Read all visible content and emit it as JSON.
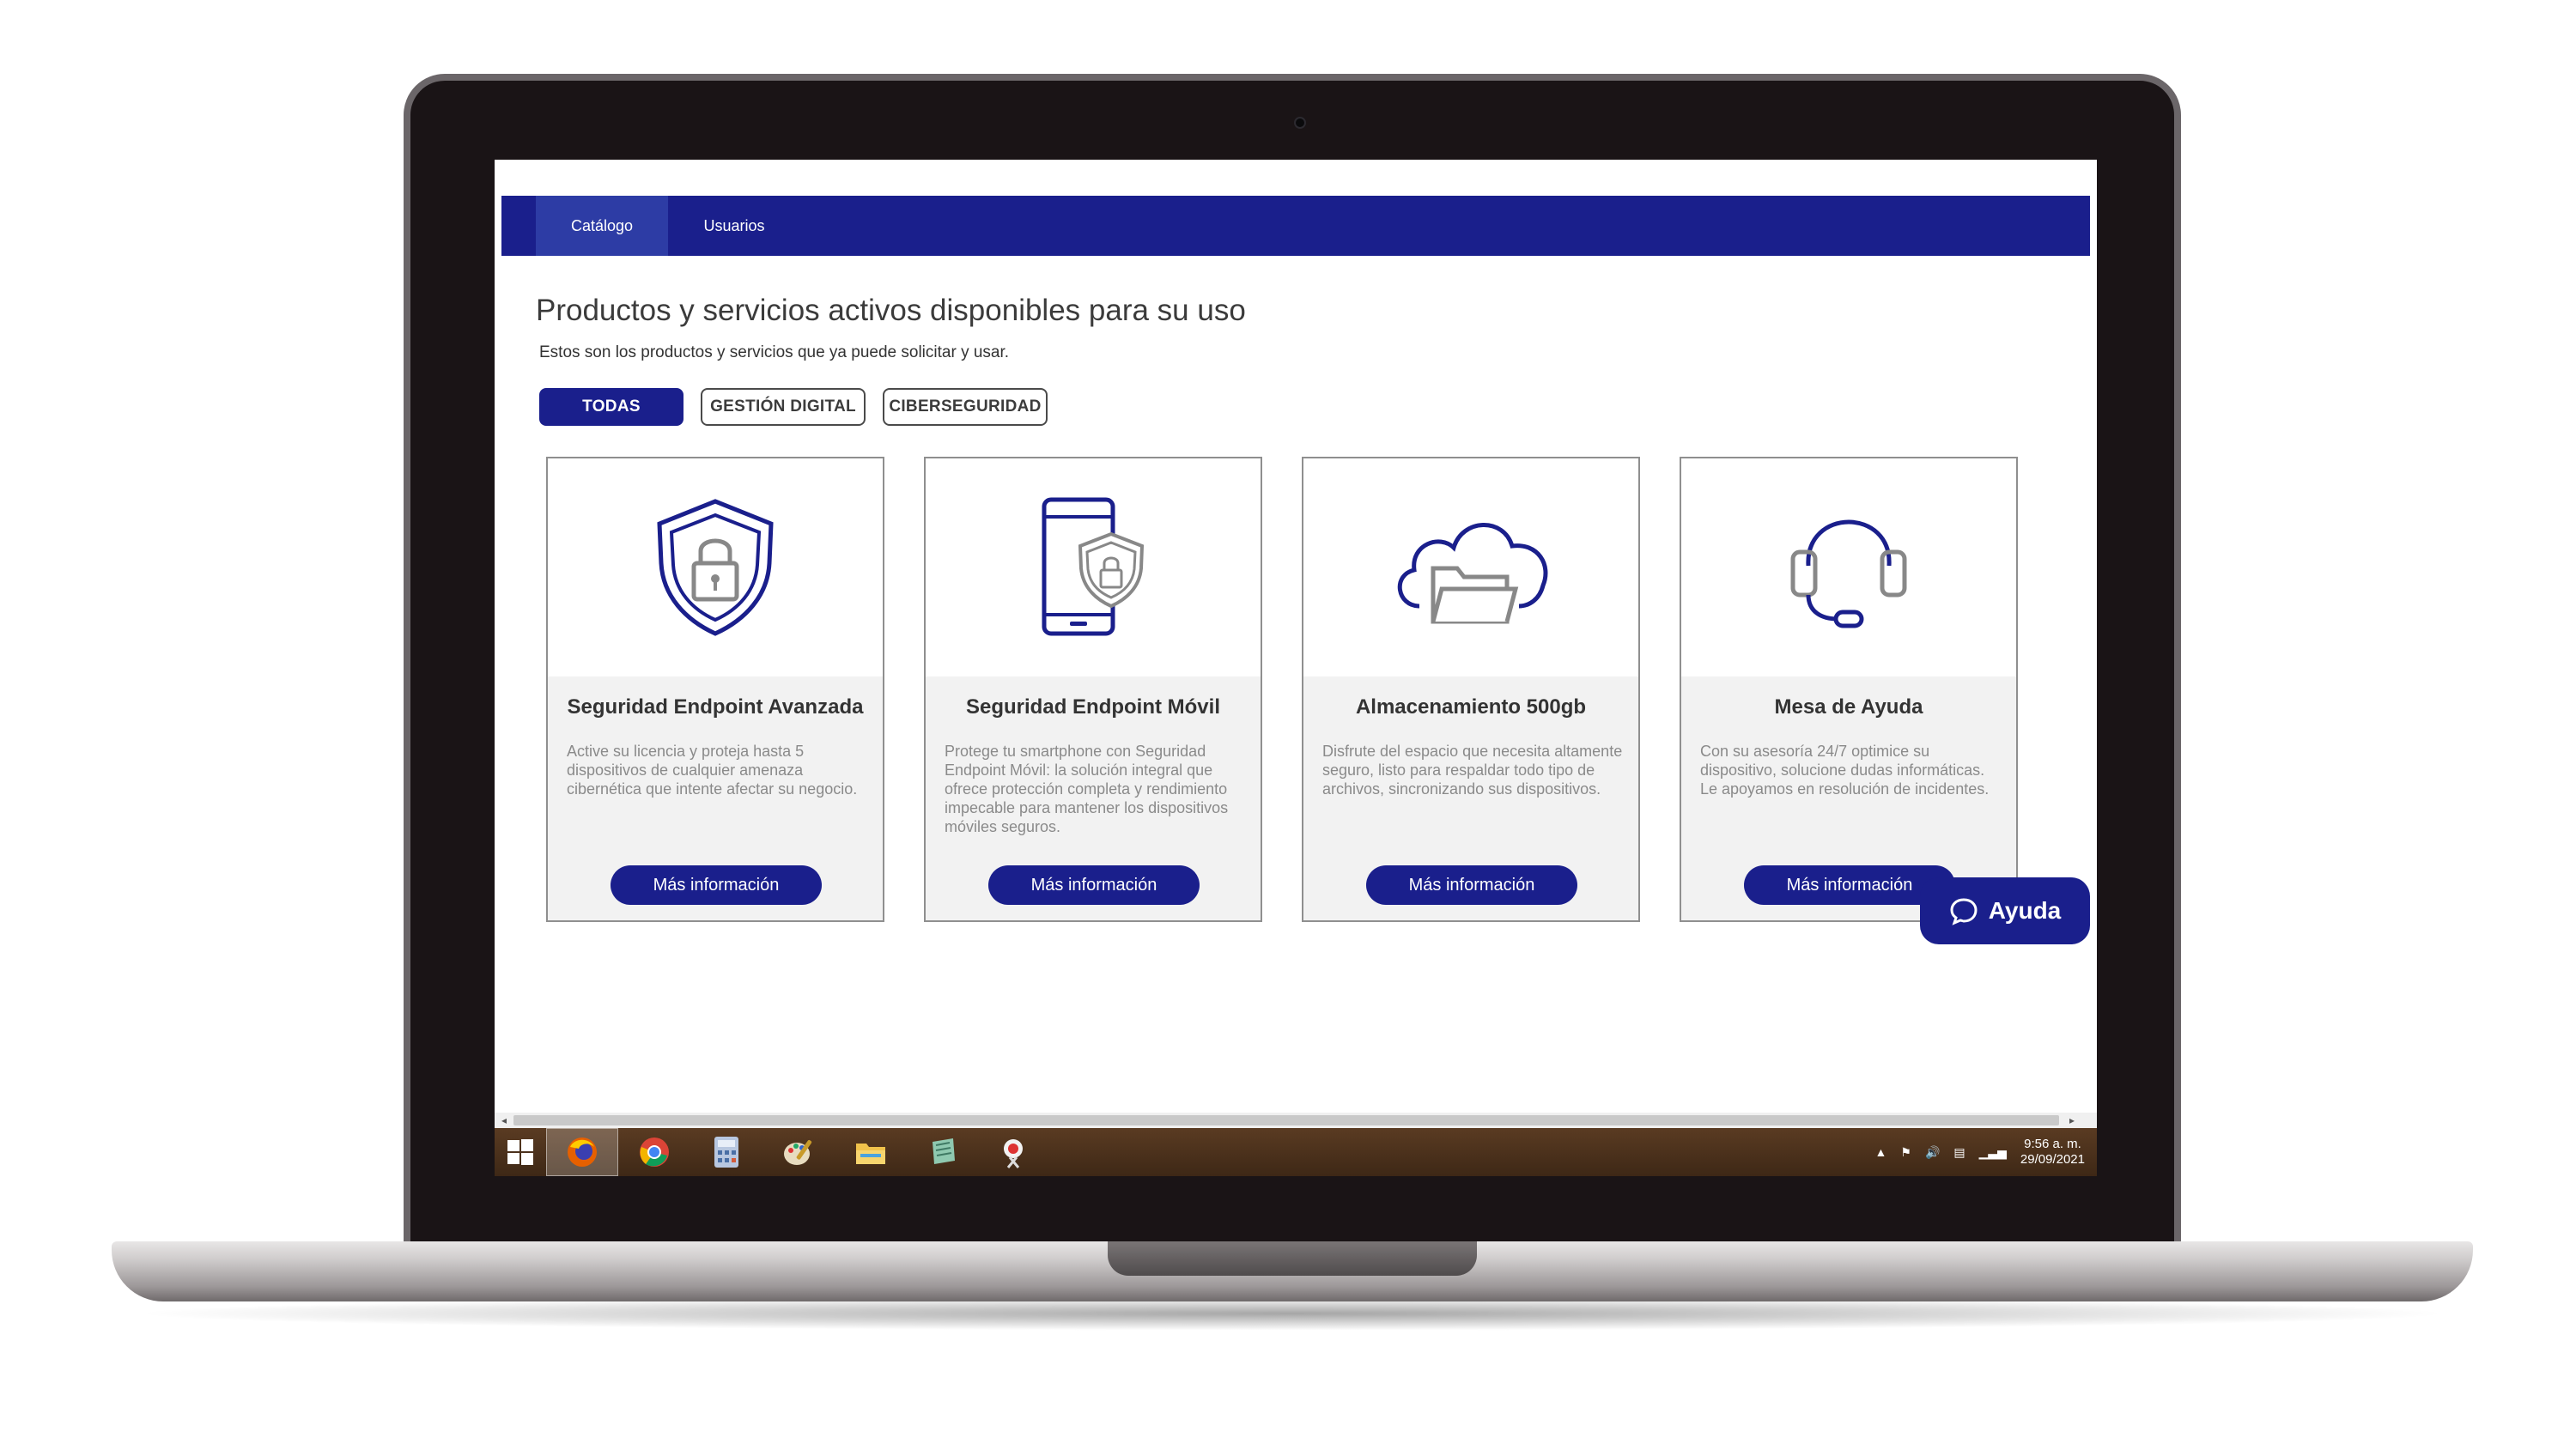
{
  "nav": {
    "tabs": [
      {
        "label": "Catálogo",
        "active": true
      },
      {
        "label": "Usuarios",
        "active": false
      }
    ]
  },
  "header": {
    "title": "Productos y servicios activos disponibles para su uso",
    "subtitle": "Estos son los productos y servicios que ya puede solicitar y usar."
  },
  "filters": [
    {
      "label": "TODAS",
      "selected": true
    },
    {
      "label": "GESTIÓN DIGITAL",
      "selected": false
    },
    {
      "label": "CIBERSEGURIDAD",
      "selected": false
    }
  ],
  "cards": [
    {
      "icon": "shield-lock-icon",
      "title": "Seguridad Endpoint Avanzada",
      "description": "Active su licencia y proteja hasta 5 dispositivos de cualquier amenaza cibernética que intente afectar su negocio.",
      "button": "Más información"
    },
    {
      "icon": "smartphone-shield-icon",
      "title": "Seguridad Endpoint Móvil",
      "description": "Protege tu smartphone con Seguridad Endpoint Móvil: la solución integral que ofrece protección completa y rendimiento impecable para mantener los dispositivos móviles seguros.",
      "button": "Más información"
    },
    {
      "icon": "cloud-folder-icon",
      "title": "Almacenamiento 500gb",
      "description": "Disfrute del espacio que necesita altamente seguro, listo para respaldar todo tipo de archivos, sincronizando sus dispositivos.",
      "button": "Más información"
    },
    {
      "icon": "headset-icon",
      "title": "Mesa de Ayuda",
      "description": "Con su asesoría 24/7 optimice su dispositivo, solucione dudas informáticas. Le apoyamos en resolución de incidentes.",
      "button": "Más información"
    }
  ],
  "help_button": {
    "label": "Ayuda",
    "icon": "chat-bubble-icon"
  },
  "taskbar": {
    "apps": [
      "firefox-icon",
      "chrome-icon",
      "calculator-icon",
      "paint-icon",
      "file-explorer-icon",
      "notes-icon",
      "snipping-tool-icon"
    ],
    "time": "9:56 a. m.",
    "date": "29/09/2021"
  },
  "colors": {
    "brand": "#1a1f8c",
    "brand_light": "#2d3ca5",
    "card_bg": "#f2f2f2"
  }
}
